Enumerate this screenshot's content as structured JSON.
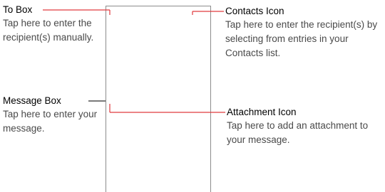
{
  "callouts": {
    "to_box": {
      "title": "To Box",
      "desc_lines": [
        "Tap here to enter the",
        "recipient(s) manually."
      ]
    },
    "contacts_icon": {
      "title": "Contacts Icon",
      "desc_lines": [
        "Tap here to enter the recipient(s) by",
        "selecting from entries in your",
        "Contacts list."
      ]
    },
    "message_box": {
      "title": "Message Box",
      "desc_lines": [
        "Tap here to enter your",
        "message."
      ]
    },
    "attachment_icon": {
      "title": "Attachment Icon",
      "desc_lines": [
        "Tap here to add an attachment to",
        "your message."
      ]
    }
  },
  "colors": {
    "leader_line": "#e03a3e",
    "phone_outline": "#8c8c8c"
  }
}
